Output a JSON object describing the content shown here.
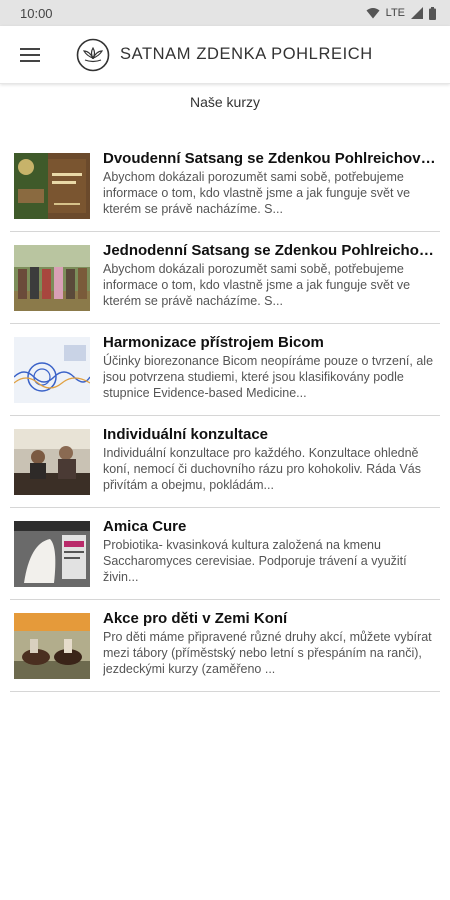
{
  "status_bar": {
    "time": "10:00",
    "network": "LTE"
  },
  "app_bar": {
    "title": "SATNAM ZDENKA POHLREICH",
    "menu_icon": "hamburger-menu-icon",
    "logo_icon": "lotus-logo-icon"
  },
  "page": {
    "section_title": "Naše kurzy"
  },
  "courses": [
    {
      "title": "Dvoudenní Satsang se Zdenkou Pohlreichovou",
      "description": "Abychom dokázali porozumět sami sobě, potřebujeme informace o tom, kdo vlastně jsme a jak funguje svět ve kterém se právě nacházíme.  S...",
      "thumbnail": "satsang-poster-thumbnail"
    },
    {
      "title": "Jednodenní Satsang se Zdenkou Pohlreichovou",
      "description": "Abychom dokázali porozumět sami sobě, potřebujeme informace o tom, kdo vlastně jsme a jak funguje svět ve kterém se právě nacházíme.  S...",
      "thumbnail": "group-photo-thumbnail"
    },
    {
      "title": "Harmonizace přístrojem Bicom",
      "description": "Účinky biorezonance Bicom neopíráme pouze o tvrzení, ale jsou potvrzena studiemi, které jsou klasifikovány podle stupnice Evidence-based Medicine...",
      "thumbnail": "bicom-waves-thumbnail"
    },
    {
      "title": "Individuální konzultace",
      "description": "Individuální konzultace pro každého. Konzultace ohledně koní, nemocí či duchovního rázu pro kohokoliv. Ráda Vás přivítám a obejmu, pokládám...",
      "thumbnail": "consultation-photo-thumbnail"
    },
    {
      "title": "Amica Cure",
      "description": "Probiotika- kvasinková kultura založená na kmenu Saccharomyces cerevisiae.\nPodporuje trávení a využití živin...",
      "thumbnail": "amica-cure-thumbnail"
    },
    {
      "title": "Akce pro děti v Zemi Koní",
      "description": "Pro děti máme připravené různé druhy akcí, můžete vybírat mezi tábory (příměstský nebo letní s přespáním na ranči), jezdeckými kurzy (zaměřeno ...",
      "thumbnail": "horse-riding-thumbnail"
    }
  ]
}
